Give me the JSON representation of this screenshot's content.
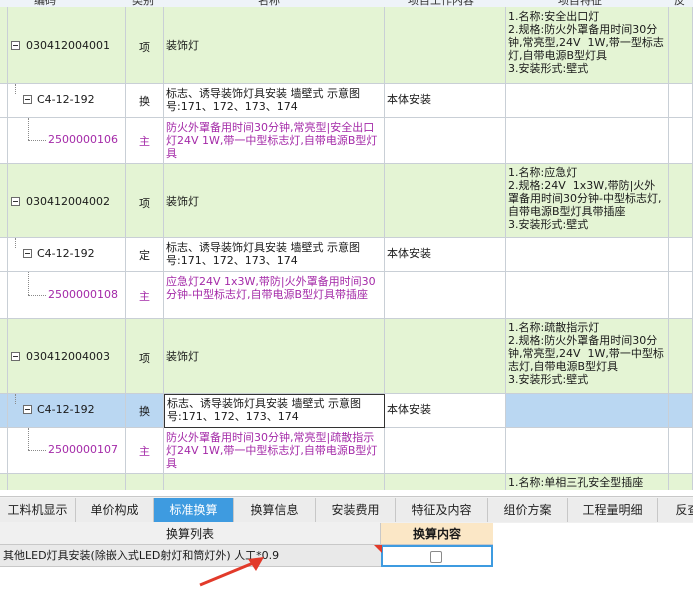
{
  "header": {
    "col_code": "编码",
    "col_type": "类别",
    "col_name": "名称",
    "col_content": "项目工作内容",
    "col_feature": "项目特征",
    "col_last": "反"
  },
  "rows": [
    {
      "kind": "item",
      "code": "030412004001",
      "type": "项",
      "name": "装饰灯",
      "content": "",
      "feature": "1.名称:安全出口灯\n2.规格:防火外罩备用时间30分钟,常亮型,24V  1W,带一型标志灯,自带电源B型灯具\n3.安装形式:壁式"
    },
    {
      "kind": "quota",
      "code": "C4-12-192",
      "type": "换",
      "name": "标志、诱导装饰灯具安装 墙壁式 示意图号:171、172、173、174",
      "content": "本体安装",
      "feature": ""
    },
    {
      "kind": "material",
      "code": "2500000106",
      "type": "主",
      "name": "防火外罩备用时间30分钟,常亮型|安全出口灯24V  1W,带一中型标志灯,自带电源B型灯具",
      "content": "",
      "feature": ""
    },
    {
      "kind": "item",
      "code": "030412004002",
      "type": "项",
      "name": "装饰灯",
      "content": "",
      "feature": "1.名称:应急灯\n2.规格:24V  1x3W,带防|火外罩备用时间30分钟-中型标志灯,自带电源B型灯具带插座\n3.安装形式:壁式"
    },
    {
      "kind": "quota",
      "code": "C4-12-192",
      "type": "定",
      "name": "标志、诱导装饰灯具安装 墙壁式 示意图号:171、172、173、174",
      "content": "本体安装",
      "feature": ""
    },
    {
      "kind": "material",
      "code": "2500000108",
      "type": "主",
      "name": "应急灯24V  1x3W,带防|火外罩备用时间30分钟-中型标志灯,自带电源B型灯具带插座",
      "content": "",
      "feature": ""
    },
    {
      "kind": "item",
      "code": "030412004003",
      "type": "项",
      "name": "装饰灯",
      "content": "",
      "feature": "1.名称:疏散指示灯\n2.规格:防火外罩备用时间30分钟,常亮型,24V  1W,带一中型标志灯,自带电源B型灯具\n3.安装形式:壁式"
    },
    {
      "kind": "quota",
      "code": "C4-12-192",
      "type": "换",
      "name": "标志、诱导装饰灯具安装 墙壁式 示意图号:171、172、173、174",
      "content": "本体安装",
      "feature": ""
    },
    {
      "kind": "material",
      "code": "2500000107",
      "type": "主",
      "name": "防火外罩备用时间30分钟,常亮型|疏散指示灯24V  1W,带一中型标志灯,自带电源B型灯具",
      "content": "",
      "feature": ""
    },
    {
      "kind": "item",
      "code": "",
      "type": "",
      "name": "",
      "content": "",
      "feature": "1.名称:单相三孔安全型插座"
    }
  ],
  "tabs": [
    "工料机显示",
    "单价构成",
    "标准换算",
    "换算信息",
    "安装费用",
    "特征及内容",
    "组价方案",
    "工程量明细",
    "反查"
  ],
  "active_tab": "标准换算",
  "panel": {
    "col_list": "换算列表",
    "col_content": "换算内容",
    "row_text": "其他LED灯具安装(除嵌入式LED射灯和筒灯外) 人工*0.9"
  },
  "colors": {
    "item_bg": "#e4f4d4",
    "selected_bg": "#bad7f2",
    "material_text": "#a42aa8",
    "active_tab": "#3e9be0",
    "arrow": "#e23a2a"
  }
}
